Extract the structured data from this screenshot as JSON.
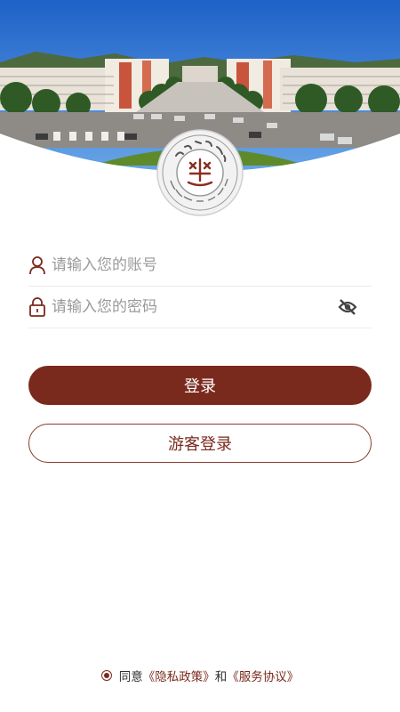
{
  "login_form": {
    "account_placeholder": "请输入您的账号",
    "password_placeholder": "请输入您的密码"
  },
  "buttons": {
    "login_label": "登录",
    "guest_login_label": "游客登录"
  },
  "agreement": {
    "prefix": "同意",
    "privacy_link": "《隐私政策》",
    "conjunction": "和",
    "service_link": "《服务协议》",
    "checked": true
  },
  "colors": {
    "brand": "#7a2a1d",
    "background": "#ffffff"
  },
  "icons": {
    "account": "user-icon",
    "password": "lock-icon",
    "toggle": "eye-off-icon",
    "logo": "university-seal-icon"
  }
}
